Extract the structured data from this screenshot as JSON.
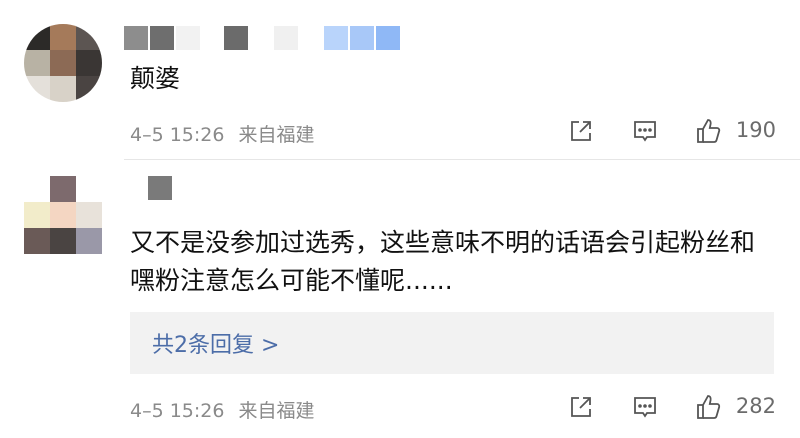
{
  "comments": [
    {
      "text": "颠婆",
      "time": "4–5 15:26",
      "location": "来自福建",
      "likes": "190"
    },
    {
      "text": "又不是没参加过选秀，这些意味不明的话语会引起粉丝和嘿粉注意怎么可能不懂呢......",
      "reply_link": "共2条回复 >",
      "time": "4–5 15:26",
      "location": "来自福建",
      "likes": "282"
    }
  ],
  "icons": [
    "share-icon",
    "comment-icon",
    "like-icon"
  ],
  "colors": {
    "link": "#4c6da8",
    "meta": "#8a8a8a",
    "reply_bg": "#f2f2f2"
  }
}
